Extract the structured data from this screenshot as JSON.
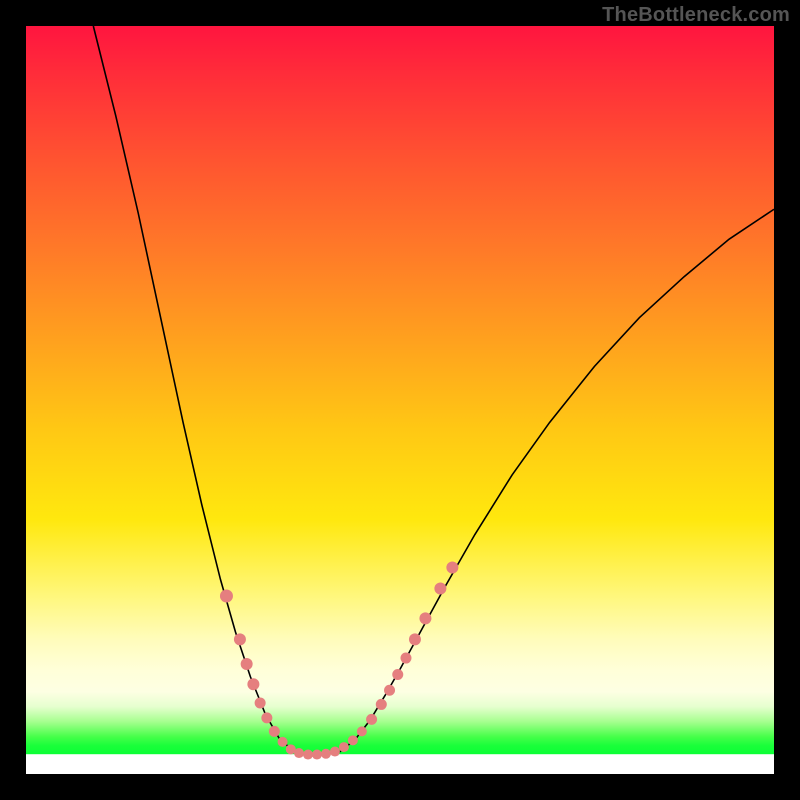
{
  "watermark": "TheBottleneck.com",
  "chart_data": {
    "type": "line",
    "title": "",
    "xlabel": "",
    "ylabel": "",
    "xlim": [
      0,
      100
    ],
    "ylim": [
      0,
      100
    ],
    "grid": false,
    "curve": {
      "comment": "V-shaped curve with steep left arm dropping to bottom near x≈33–42 then rising shallower on right. Values are % of plot area, origin top-left.",
      "points": [
        {
          "x": 9.0,
          "y": 0.0
        },
        {
          "x": 12.0,
          "y": 12.0
        },
        {
          "x": 15.0,
          "y": 25.0
        },
        {
          "x": 18.0,
          "y": 39.0
        },
        {
          "x": 21.0,
          "y": 53.0
        },
        {
          "x": 23.5,
          "y": 64.0
        },
        {
          "x": 26.0,
          "y": 74.0
        },
        {
          "x": 28.0,
          "y": 81.0
        },
        {
          "x": 30.0,
          "y": 87.0
        },
        {
          "x": 32.0,
          "y": 92.0
        },
        {
          "x": 34.0,
          "y": 95.5
        },
        {
          "x": 36.0,
          "y": 97.0
        },
        {
          "x": 38.0,
          "y": 97.4
        },
        {
          "x": 40.0,
          "y": 97.4
        },
        {
          "x": 42.0,
          "y": 97.0
        },
        {
          "x": 44.0,
          "y": 95.4
        },
        {
          "x": 46.0,
          "y": 92.8
        },
        {
          "x": 48.0,
          "y": 89.5
        },
        {
          "x": 50.0,
          "y": 86.0
        },
        {
          "x": 53.0,
          "y": 80.5
        },
        {
          "x": 56.0,
          "y": 75.0
        },
        {
          "x": 60.0,
          "y": 68.0
        },
        {
          "x": 65.0,
          "y": 60.0
        },
        {
          "x": 70.0,
          "y": 53.0
        },
        {
          "x": 76.0,
          "y": 45.5
        },
        {
          "x": 82.0,
          "y": 39.0
        },
        {
          "x": 88.0,
          "y": 33.5
        },
        {
          "x": 94.0,
          "y": 28.5
        },
        {
          "x": 100.0,
          "y": 24.5
        }
      ]
    },
    "markers": {
      "comment": "Salmon dots highlighting regions near minimum and part-way up both arms. r in px.",
      "points": [
        {
          "x": 26.8,
          "y": 76.2,
          "r": 6.5
        },
        {
          "x": 28.6,
          "y": 82.0,
          "r": 6.0
        },
        {
          "x": 29.5,
          "y": 85.3,
          "r": 6.0
        },
        {
          "x": 30.4,
          "y": 88.0,
          "r": 6.0
        },
        {
          "x": 31.3,
          "y": 90.5,
          "r": 5.5
        },
        {
          "x": 32.2,
          "y": 92.5,
          "r": 5.5
        },
        {
          "x": 33.2,
          "y": 94.3,
          "r": 5.5
        },
        {
          "x": 34.3,
          "y": 95.7,
          "r": 5.0
        },
        {
          "x": 35.4,
          "y": 96.7,
          "r": 5.0
        },
        {
          "x": 36.5,
          "y": 97.2,
          "r": 5.0
        },
        {
          "x": 37.7,
          "y": 97.4,
          "r": 5.0
        },
        {
          "x": 38.9,
          "y": 97.4,
          "r": 5.0
        },
        {
          "x": 40.1,
          "y": 97.3,
          "r": 5.0
        },
        {
          "x": 41.3,
          "y": 97.0,
          "r": 5.0
        },
        {
          "x": 42.5,
          "y": 96.4,
          "r": 5.0
        },
        {
          "x": 43.7,
          "y": 95.5,
          "r": 5.0
        },
        {
          "x": 44.9,
          "y": 94.3,
          "r": 5.0
        },
        {
          "x": 46.2,
          "y": 92.7,
          "r": 5.5
        },
        {
          "x": 47.5,
          "y": 90.7,
          "r": 5.5
        },
        {
          "x": 48.6,
          "y": 88.8,
          "r": 5.5
        },
        {
          "x": 49.7,
          "y": 86.7,
          "r": 5.5
        },
        {
          "x": 50.8,
          "y": 84.5,
          "r": 5.5
        },
        {
          "x": 52.0,
          "y": 82.0,
          "r": 6.0
        },
        {
          "x": 53.4,
          "y": 79.2,
          "r": 6.0
        },
        {
          "x": 55.4,
          "y": 75.2,
          "r": 6.0
        },
        {
          "x": 57.0,
          "y": 72.4,
          "r": 6.0
        }
      ]
    }
  }
}
